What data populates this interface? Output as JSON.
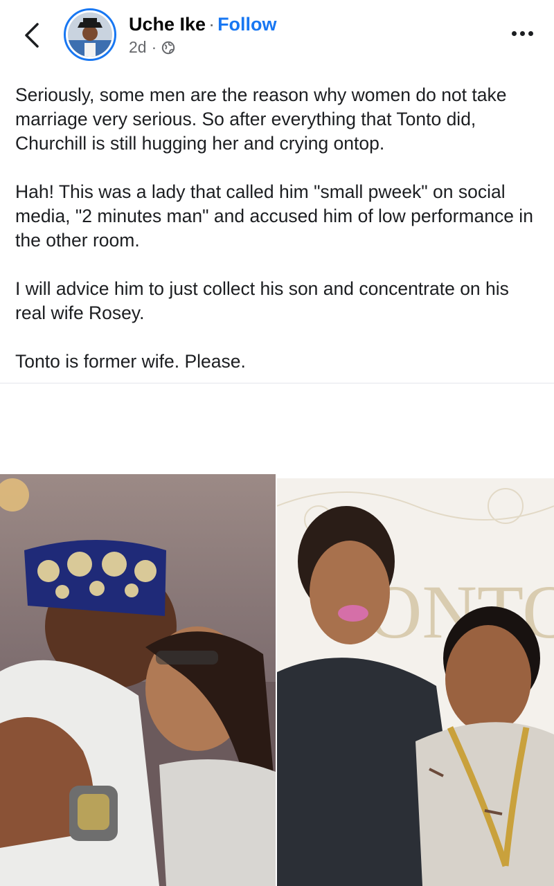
{
  "header": {
    "author": "Uche Ike",
    "separator": "·",
    "follow_label": "Follow",
    "time": "2d",
    "meta_separator": "·",
    "privacy_icon": "globe-icon",
    "back_icon": "chevron-left-icon",
    "more_icon": "more-horizontal-icon"
  },
  "post": {
    "paragraphs": [
      "Seriously, some men are the reason why women do not take marriage very serious. So after everything that Tonto did, Churchill is still hugging her and crying ontop.",
      "Hah! This was a lady that called him \"small pweek\" on social media, \"2 minutes man\" and accused him of low performance in the other room.",
      "I will advice him to just collect his son and concentrate on his real wife Rosey.",
      "Tonto is former wife. Please."
    ]
  },
  "media": {
    "left_photo": "photo of a man in embroidered cap hugging a woman",
    "right_photo": "photo of a woman and a man posing together",
    "backdrop_text": "ONTO"
  },
  "colors": {
    "accent": "#1877f2",
    "text": "#1c1e21",
    "secondary": "#65676b"
  }
}
